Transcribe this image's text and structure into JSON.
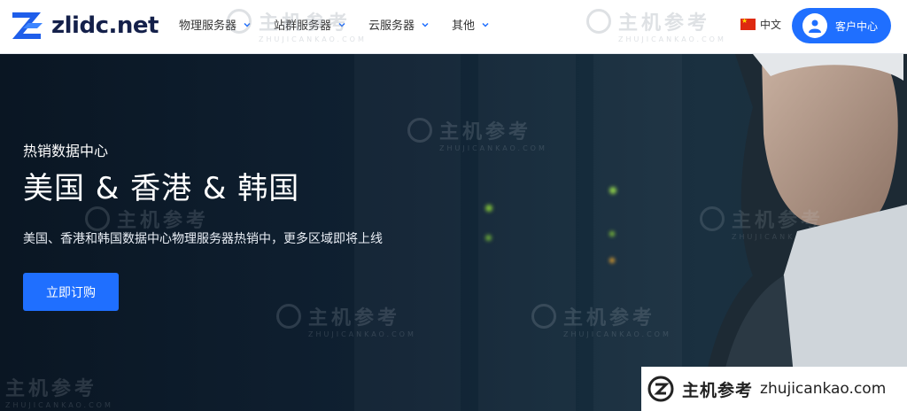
{
  "header": {
    "logo_text": "zlidc.net",
    "nav": [
      {
        "label": "物理服务器"
      },
      {
        "label": "站群服务器"
      },
      {
        "label": "云服务器"
      },
      {
        "label": "其他"
      }
    ],
    "language": "中文",
    "client_center": "客户中心"
  },
  "hero": {
    "subtitle": "热销数据中心",
    "title": "美国 & 香港 & 韩国",
    "description": "美国、香港和韩国数据中心物理服务器热销中，更多区域即将上线",
    "cta_label": "立即订购"
  },
  "watermark": {
    "cn": "主机参考",
    "en": "ZHUJICANKAO.COM"
  },
  "site_badge": {
    "cn": "主机参考",
    "en": "zhujicankao.com"
  },
  "colors": {
    "accent": "#1f6fff",
    "logo": "#14204a",
    "hero_bg": "#0f2031"
  }
}
